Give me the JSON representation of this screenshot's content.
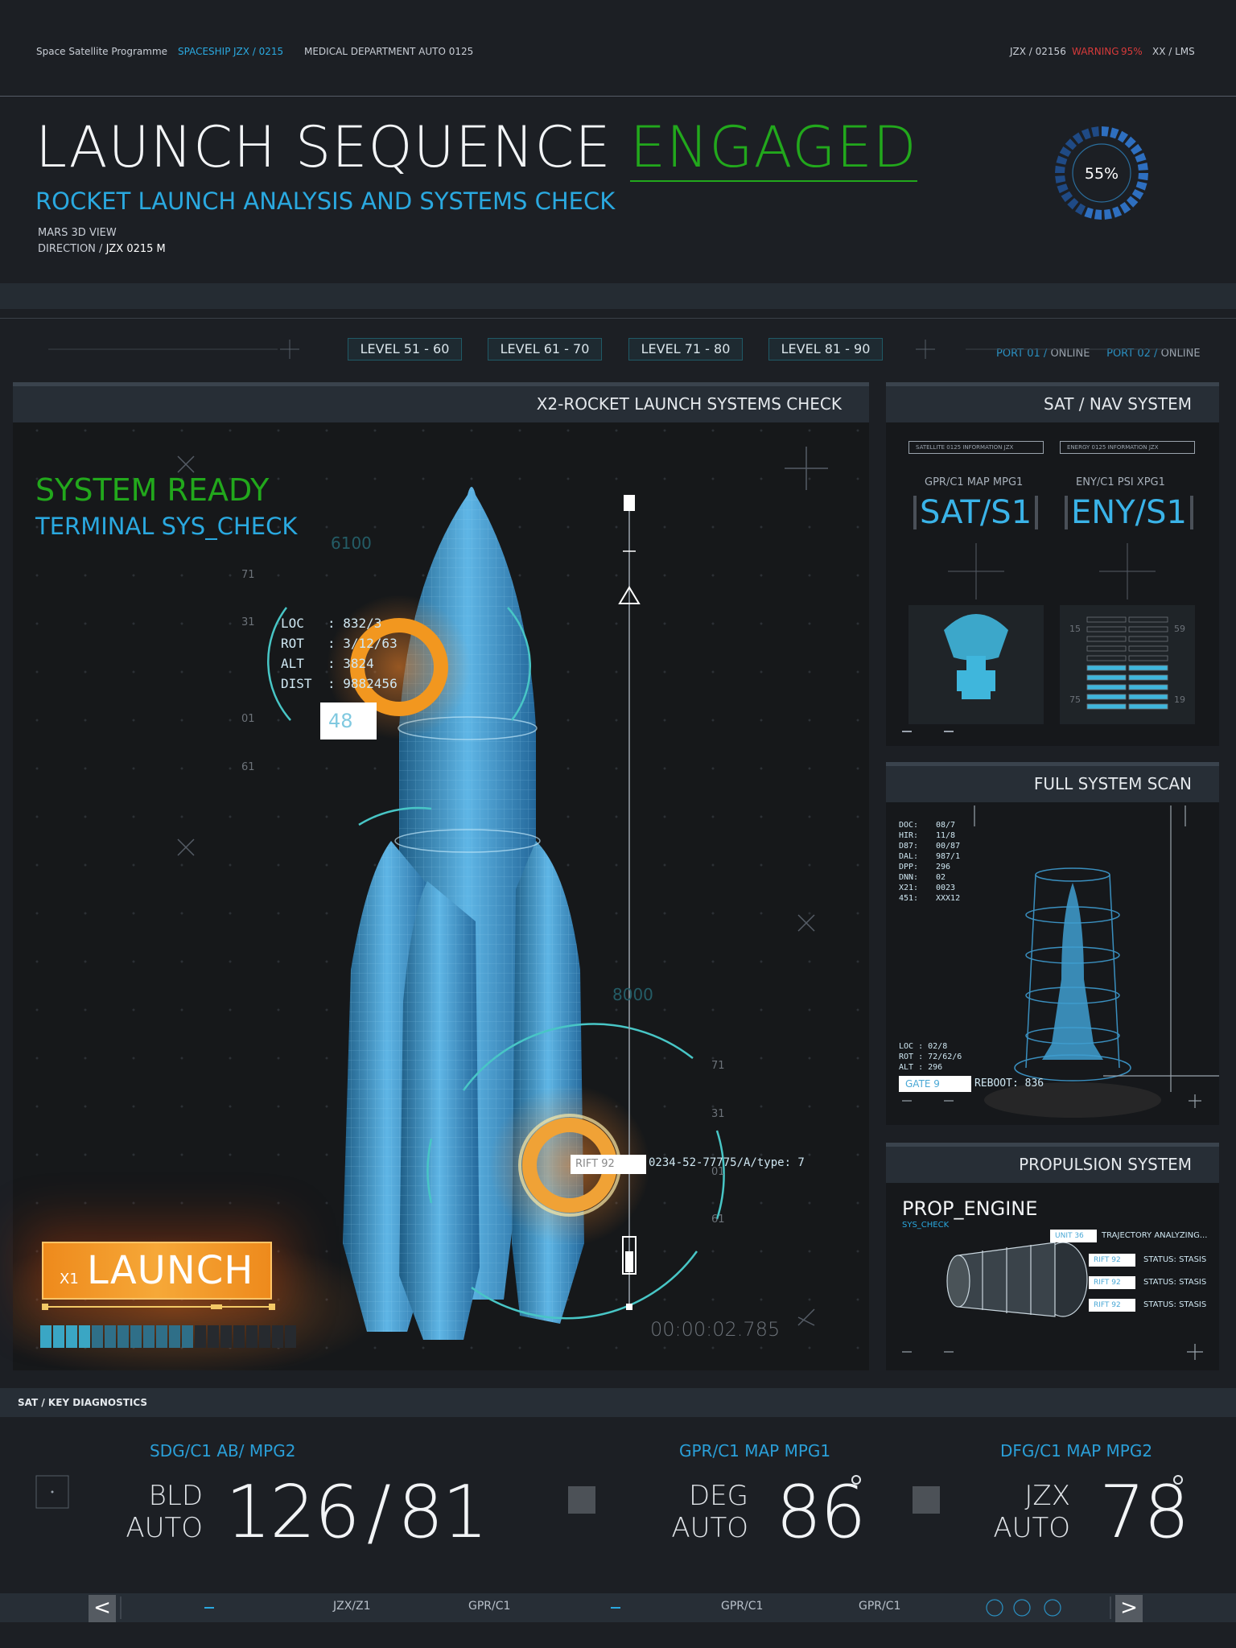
{
  "topbar": {
    "programme": "Space Satellite Programme",
    "spaceship_label": "SPACESHIP",
    "spaceship_id": "JZX / 0215",
    "medical": "MEDICAL DEPARTMENT AUTO 0125",
    "code": "JZX / 02156",
    "warning_label": "WARNING",
    "warning_value": "95%",
    "lms": "XX / LMS"
  },
  "hero": {
    "title_main": "LAUNCH SEQUENCE",
    "title_accent": "ENGAGED",
    "subtitle": "ROCKET LAUNCH ANALYSIS AND SYSTEMS CHECK",
    "view": "MARS 3D VIEW",
    "direction_label": "DIRECTION /",
    "direction_value": "JZX 0215  M",
    "gauge_value": "55%",
    "gauge_fraction": 0.55,
    "ports": [
      {
        "name": "PORT 01",
        "sep": "/",
        "status": "ONLINE"
      },
      {
        "name": "PORT 02",
        "sep": "/",
        "status": "ONLINE"
      }
    ]
  },
  "levels": [
    "LEVEL 51 - 60",
    "LEVEL 61 - 70",
    "LEVEL 71 - 80",
    "LEVEL 81 - 90"
  ],
  "main_panel": {
    "title": "X2-ROCKET LAUNCH SYSTEMS CHECK",
    "status_title": "SYSTEM READY",
    "status_sub": "TERMINAL SYS_CHECK",
    "telemetry": [
      {
        "key": "LOC",
        "value": ": 832/3"
      },
      {
        "key": "ROT",
        "value": ": 3/12/63"
      },
      {
        "key": "ALT",
        "value": ": 3824"
      },
      {
        "key": "DIST",
        "value": ": 9882456"
      }
    ],
    "marker_value": "48",
    "altitude_top": "6100",
    "altitude_mid": "8000",
    "left_ticks": [
      "71",
      "31",
      "01",
      "61"
    ],
    "right_ticks": [
      "71",
      "31",
      "01",
      "61"
    ],
    "rift_tag": "RIFT 92",
    "rift_code": "0234-52-77775/A/type: 7",
    "launch_multiplier": "X1",
    "launch_label": "LAUNCH",
    "launch_progress": 0.58,
    "timer": "00:00:02.785"
  },
  "sat_panel": {
    "title": "SAT / NAV SYSTEM",
    "left": {
      "tabs": "GPR/C1   MAP   MPG1",
      "code": "SAT/S1",
      "info": "SATELLITE 0125    INFORMATION JZX"
    },
    "right": {
      "tabs": "ENY/C1    PSI    XPG1",
      "code": "ENY/S1",
      "info": "ENERGY 0125    INFORMATION JZX"
    },
    "scale_left": [
      "15",
      "75"
    ],
    "scale_right": [
      "59",
      "19"
    ]
  },
  "scan_panel": {
    "title": "FULL SYSTEM SCAN",
    "readout": [
      {
        "k": "DOC:",
        "v": "08/7"
      },
      {
        "k": "HIR:",
        "v": "11/8"
      },
      {
        "k": "D87:",
        "v": "00/87"
      },
      {
        "k": "DAL:",
        "v": "987/1"
      },
      {
        "k": "DPP:",
        "v": "296"
      },
      {
        "k": "DNN:",
        "v": "02"
      },
      {
        "k": "X21:",
        "v": "0023"
      },
      {
        "k": "451:",
        "v": "XXX12"
      }
    ],
    "mini": [
      {
        "k": "LOC",
        "v": ": 02/8"
      },
      {
        "k": "ROT",
        "v": ": 72/62/6"
      },
      {
        "k": "ALT",
        "v": ": 296"
      }
    ],
    "gate": "GATE 9",
    "reboot": "REBOOT: 836"
  },
  "prop_panel": {
    "title": "PROPULSION SYSTEM",
    "engine": "PROP_ENGINE",
    "check": "SYS_CHECK",
    "unit_tag": "UNIT 36",
    "unit_status": "TRAJECTORY ANALYZING...",
    "rows": [
      {
        "tag": "RIFT 92",
        "status": "STATUS: STASIS"
      },
      {
        "tag": "RIFT 92",
        "status": "STATUS: STASIS"
      },
      {
        "tag": "RIFT 92",
        "status": "STATUS: STASIS"
      }
    ]
  },
  "diagnostics": {
    "title": "SAT / KEY DIAGNOSTICS",
    "blocks": [
      {
        "label": "SDG/C1   AB/   MPG2",
        "k1": "BLD",
        "k2": "AUTO",
        "value_a": "126",
        "slash": "/",
        "value_b": "81"
      },
      {
        "label": "GPR/C1   MAP   MPG1",
        "k1": "DEG",
        "k2": "AUTO",
        "value": "86"
      },
      {
        "label": "DFG/C1   MAP   MPG2",
        "k1": "JZX",
        "k2": "AUTO",
        "value": "78"
      }
    ]
  },
  "navbar": {
    "prev": "<",
    "next": ">",
    "items": [
      "JZX/Z1",
      "GPR/C1",
      "GPR/C1",
      "GPR/C1"
    ]
  },
  "colors": {
    "accent_blue": "#2aa9e0",
    "accent_green": "#22a81c",
    "warning": "#d63a3a",
    "launch_orange": "#f2971f"
  }
}
